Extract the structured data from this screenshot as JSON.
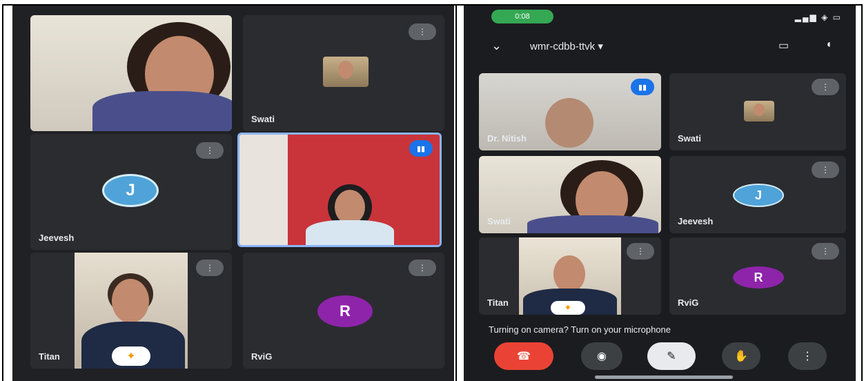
{
  "left_screen": {
    "tiles": [
      {
        "name": ""
      },
      {
        "name": "Swati"
      },
      {
        "name": "Jeevesh"
      },
      {
        "name": ""
      },
      {
        "name": "Titan"
      },
      {
        "name": "RviG"
      }
    ],
    "avatars": {
      "jeevesh": "J",
      "rvig": "R"
    },
    "more_icon": "⋮",
    "mic_icon": "▮▮"
  },
  "right_screen": {
    "status": {
      "time_pill": "0:08",
      "signal": "▂▄▆ ◈ ▭"
    },
    "meeting_code": "wmr-cdbb-ttvk",
    "meeting_chevron": "▾",
    "tiles": [
      {
        "name": "Dr. Nitish"
      },
      {
        "name": "Swati"
      },
      {
        "name": "Swati"
      },
      {
        "name": "Jeevesh"
      },
      {
        "name": "Titan"
      },
      {
        "name": "RviG"
      }
    ],
    "avatars": {
      "jeevesh": "J",
      "rvig": "R"
    },
    "caption": "Turning on camera? Turn on your microphone",
    "controls": {
      "end": "☎",
      "camera": "◉",
      "mic": "✎",
      "hand": "✋",
      "more": "⋮"
    }
  },
  "colors": {
    "accent": "#8ab4f8",
    "end_call": "#ea4335",
    "bg": "#202124",
    "avatar_j": "#4fa3d8",
    "avatar_r": "#8e24aa"
  }
}
